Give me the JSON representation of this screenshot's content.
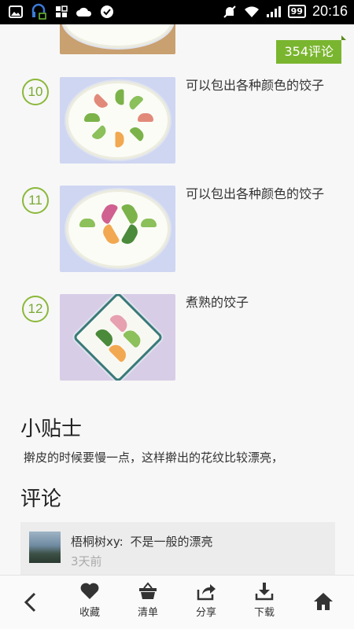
{
  "status_bar": {
    "time": "20:16",
    "battery": "99"
  },
  "comments_badge": "354评论",
  "steps": [
    {
      "number": "10",
      "text": "可以包出各种颜色的饺子"
    },
    {
      "number": "11",
      "text": "可以包出各种颜色的饺子"
    },
    {
      "number": "12",
      "text": "煮熟的饺子"
    }
  ],
  "tips": {
    "title": "小贴士",
    "text": "擀皮的时候要慢一点，这样擀出的花纹比较漂亮，"
  },
  "comments": {
    "title": "评论",
    "items": [
      {
        "user": "梧桐树xy:",
        "text": "不是一般的漂亮",
        "time": "3天前"
      }
    ]
  },
  "bottom_bar": {
    "favorite": "收藏",
    "list": "清单",
    "share": "分享",
    "download": "下载"
  },
  "icons": {
    "back": "back-arrow-icon",
    "favorite": "heart-icon",
    "list": "basket-icon",
    "share": "share-icon",
    "download": "download-icon",
    "home": "home-icon"
  },
  "colors": {
    "accent": "#7ab52f",
    "statusbar": "#000000"
  }
}
